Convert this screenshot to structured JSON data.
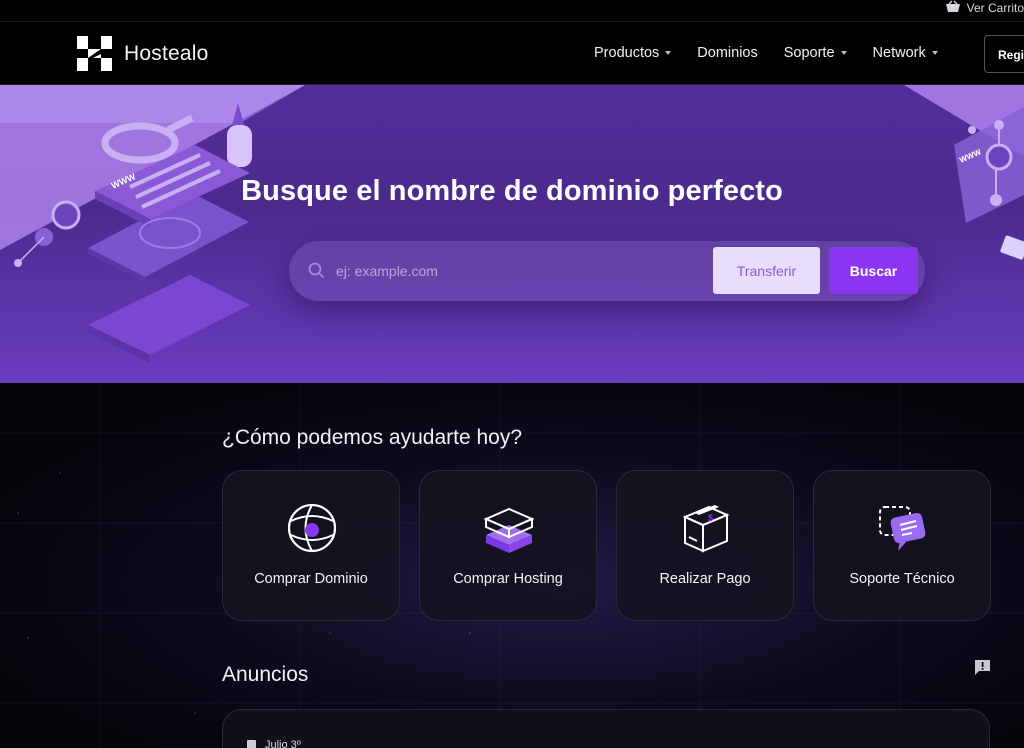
{
  "topbar": {
    "cart_label": "Ver Carrito"
  },
  "brand": {
    "name": "Hostealo"
  },
  "nav": {
    "items": [
      {
        "label": "Productos",
        "dropdown": true
      },
      {
        "label": "Dominios",
        "dropdown": false
      },
      {
        "label": "Soporte",
        "dropdown": true
      },
      {
        "label": "Network",
        "dropdown": true
      }
    ],
    "register_label": "Registrarse"
  },
  "hero": {
    "title": "Busque el nombre de dominio perfecto",
    "search_placeholder": "ej: example.com",
    "transfer_label": "Transferir",
    "search_label": "Buscar",
    "illustration_left_label": "WWW",
    "illustration_right_label": "WWW"
  },
  "help": {
    "title": "¿Cómo podemos ayudarte hoy?",
    "cards": [
      {
        "label": "Comprar Dominio",
        "icon": "globe-icon"
      },
      {
        "label": "Comprar Hosting",
        "icon": "server-stack-icon"
      },
      {
        "label": "Realizar Pago",
        "icon": "payment-box-icon"
      },
      {
        "label": "Soporte Técnico",
        "icon": "chat-bubbles-icon"
      }
    ]
  },
  "announcements": {
    "title": "Anuncios",
    "first_date": "Julio 3º"
  },
  "colors": {
    "accent": "#8a35f0",
    "hero_bg": "#4b2a8c",
    "page_bg": "#05040a"
  }
}
